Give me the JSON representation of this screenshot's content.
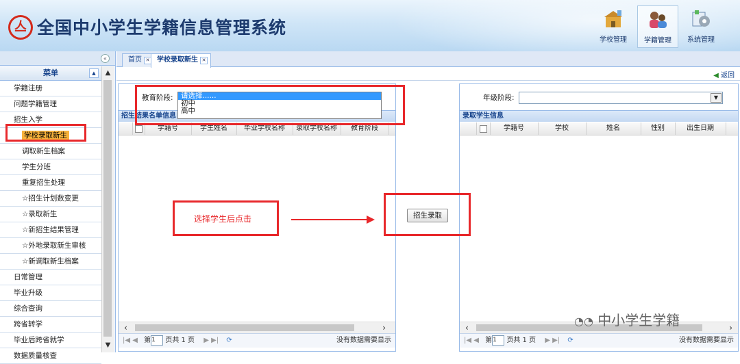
{
  "app": {
    "logo_char": "亼",
    "title": "全国中小学生学籍信息管理系统"
  },
  "topnav": [
    {
      "label": "学校管理"
    },
    {
      "label": "学籍管理"
    },
    {
      "label": "系统管理"
    }
  ],
  "sidebar": {
    "collapse_icon": "«",
    "menu_title": "菜单",
    "items": [
      {
        "label": "学籍注册"
      },
      {
        "label": "问题学籍管理"
      },
      {
        "label": "招生入学"
      },
      {
        "label": "学校录取新生"
      },
      {
        "label": "调取新生档案"
      },
      {
        "label": "学生分班"
      },
      {
        "label": "重复招生处理"
      },
      {
        "label": "☆招生计划数变更"
      },
      {
        "label": "☆录取新生"
      },
      {
        "label": "☆新招生结果管理"
      },
      {
        "label": "☆外地录取新生审核"
      },
      {
        "label": "☆新调取新生档案"
      },
      {
        "label": "日常管理"
      },
      {
        "label": "毕业升级"
      },
      {
        "label": "综合查询"
      },
      {
        "label": "跨省转学"
      },
      {
        "label": "毕业后跨省就学"
      },
      {
        "label": "数据质量核查"
      }
    ]
  },
  "tabs": [
    {
      "label": "首页"
    },
    {
      "label": "学校录取新生"
    }
  ],
  "return_label": "返回",
  "left_panel": {
    "edu_label": "教育阶段:",
    "dropdown_options": [
      "请选择......",
      "初中",
      "高中"
    ],
    "title": "招生结果名单信息",
    "columns": [
      "学籍号",
      "学生姓名",
      "毕业学校名称",
      "录取学校名称",
      "教育阶段"
    ],
    "pager": {
      "page_prefix": "第",
      "page_value": "1",
      "page_suffix": "页共 1 页",
      "empty": "没有数据需要显示"
    }
  },
  "admit_button": "招生录取",
  "right_panel": {
    "grade_label": "年级阶段:",
    "title": "录取学生信息",
    "columns": [
      "学籍号",
      "学校",
      "姓名",
      "性别",
      "出生日期"
    ],
    "pager": {
      "page_prefix": "第",
      "page_value": "1",
      "page_suffix": "页共 1 页",
      "empty": "没有数据需要显示"
    }
  },
  "annotation": "选择学生后点击",
  "watermark": "中小学生学籍"
}
